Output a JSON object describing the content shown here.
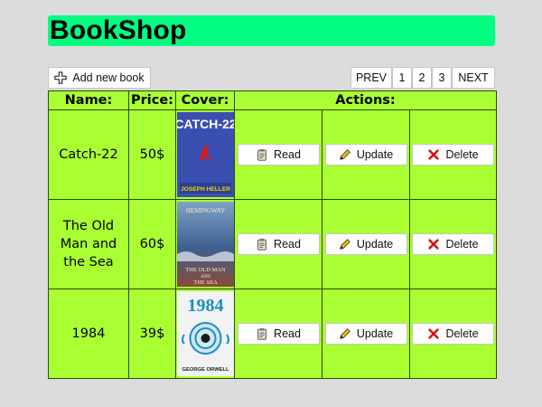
{
  "app": {
    "title": "BookShop"
  },
  "toolbar": {
    "add_label": "Add new book",
    "add_icon": "plus-icon"
  },
  "pagination": {
    "prev_label": "PREV",
    "pages": [
      "1",
      "2",
      "3"
    ],
    "next_label": "NEXT"
  },
  "table": {
    "headers": {
      "name": "Name:",
      "price": "Price:",
      "cover": "Cover:",
      "actions": "Actions:"
    },
    "action_labels": {
      "read": "Read",
      "update": "Update",
      "delete": "Delete"
    },
    "rows": [
      {
        "name": "Catch-22",
        "price": "50$",
        "cover": {
          "title": "CATCH-22",
          "author": "JOSEPH HELLER",
          "bg": "#3a4fb0",
          "accent": "#d21f1f"
        }
      },
      {
        "name": "The Old Man and the Sea",
        "price": "60$",
        "cover": {
          "author": "HEMINGWAY",
          "line1": "THE OLD MAN",
          "line2": "AND",
          "line3": "THE SEA",
          "bg": "#4a6fa0"
        }
      },
      {
        "name": "1984",
        "price": "39$",
        "cover": {
          "title": "1984",
          "author": "GEORGE ORWELL",
          "bg": "#f1f2f3",
          "accent": "#1a8fc0"
        }
      }
    ]
  },
  "colors": {
    "header": "#00ff80",
    "table_bg": "#aaff33",
    "page_bg": "#dcdcdc"
  }
}
